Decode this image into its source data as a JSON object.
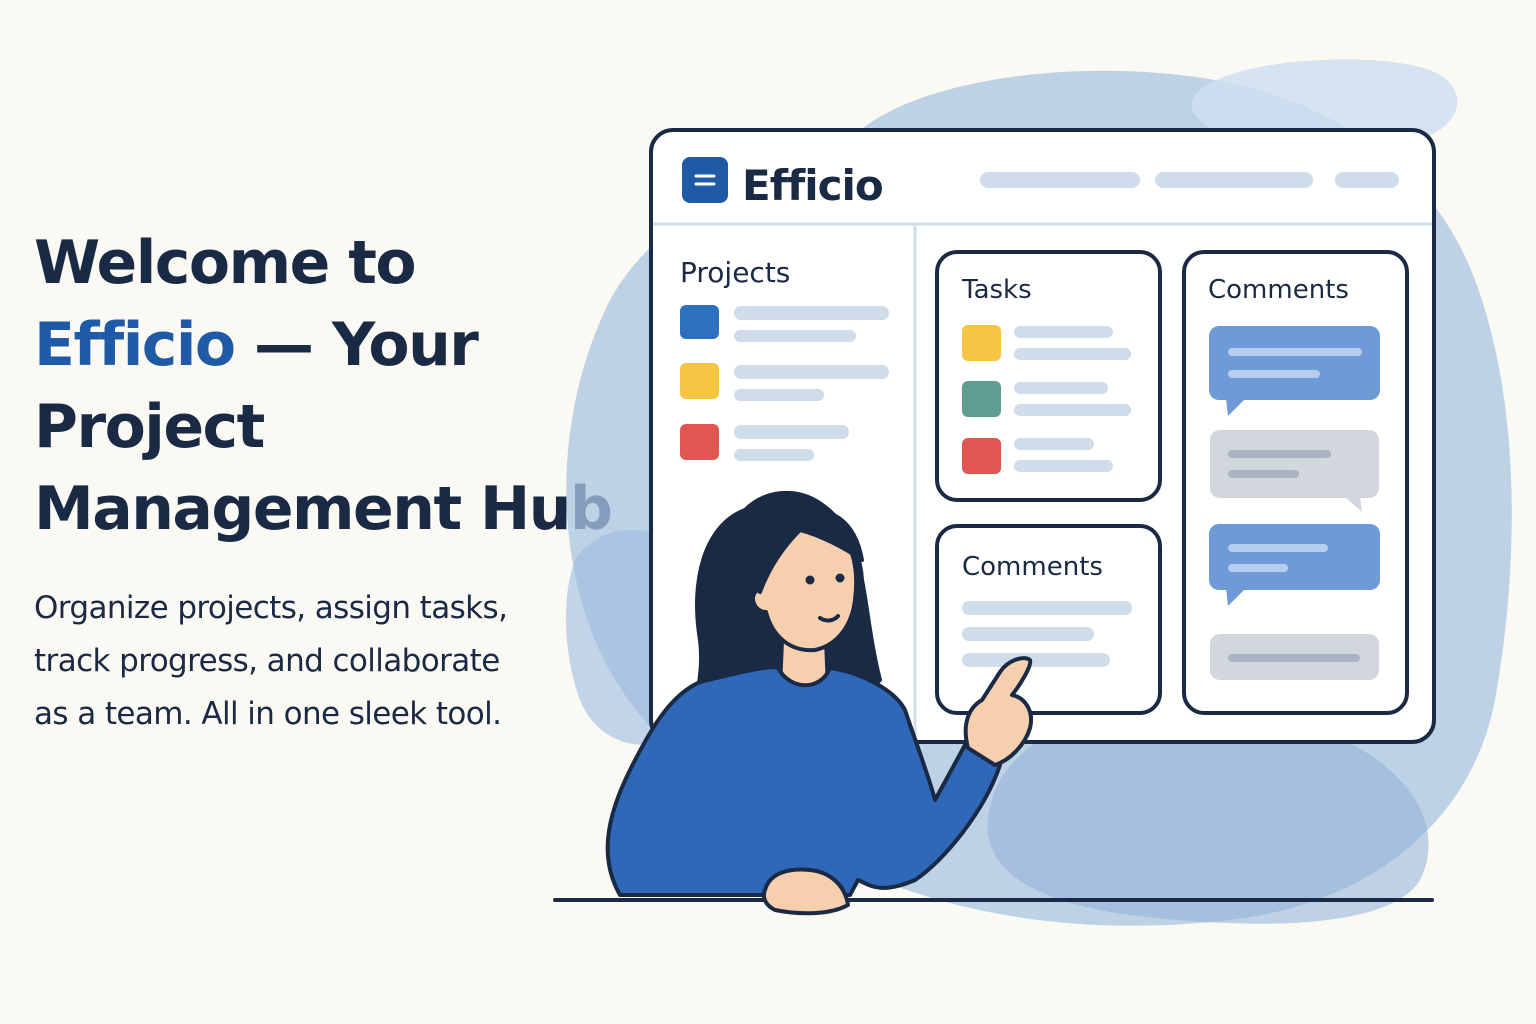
{
  "hero": {
    "line1": "Welcome to",
    "brand": "Efficio",
    "line2_rest": " — Your",
    "line3": "Project",
    "line4": "Management Hub",
    "sub_line1": "Organize projects, assign tasks,",
    "sub_line2": "track progress, and collaborate",
    "sub_line3": "as a team. All in one sleek tool."
  },
  "app_window": {
    "title": "Efficio",
    "logo_icon": "menu-icon",
    "projects_title": "Projects",
    "tasks_title": "Tasks",
    "comments_small_title": "Comments",
    "comments_title": "Comments"
  },
  "colors": {
    "navy": "#1a2a45",
    "brand_blue": "#1f5aa6",
    "background": "#fbf9f4",
    "blob": "#a9c4e2",
    "placeholder": "#cfdcea",
    "project_blue": "#2f6fc0",
    "yellow": "#f7c544",
    "red": "#df5652",
    "teal": "#5e9e90",
    "bubble_blue": "#6f9ad8",
    "bubble_gray": "#d2d7de",
    "shirt": "#2f67b9",
    "skin": "#f6cfae"
  }
}
